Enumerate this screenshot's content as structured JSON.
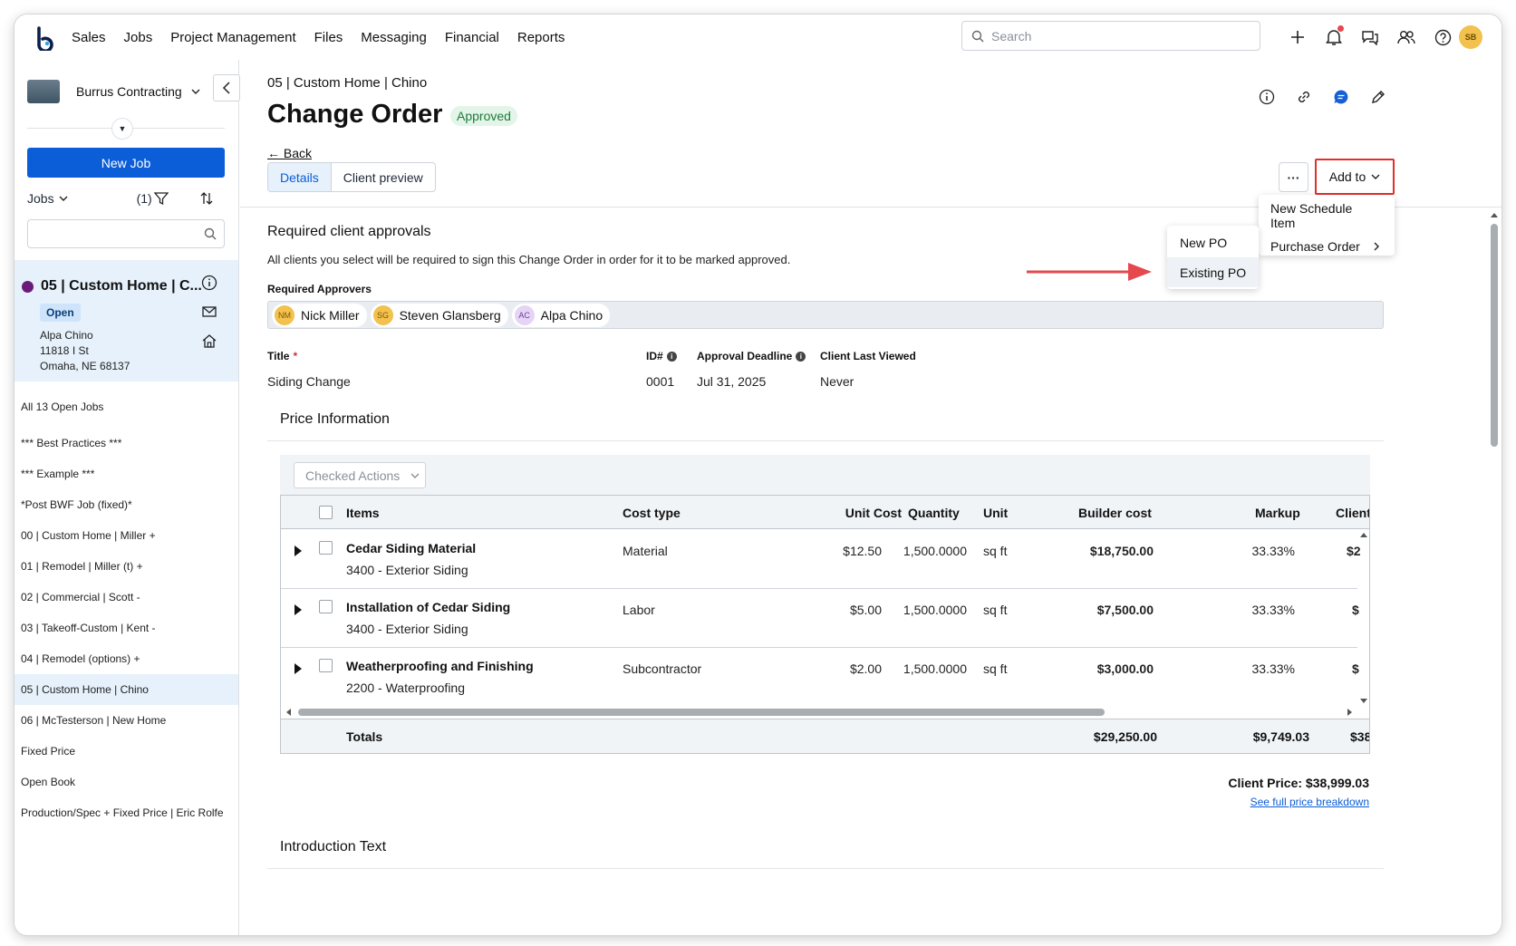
{
  "nav": {
    "links": [
      "Sales",
      "Jobs",
      "Project Management",
      "Files",
      "Messaging",
      "Financial",
      "Reports"
    ],
    "search_placeholder": "Search",
    "user_initials": "SB"
  },
  "sidebar": {
    "company": "Burrus Contracting",
    "new_job": "New Job",
    "jobs_label": "Jobs",
    "filter_count": "(1)",
    "active_job": {
      "title": "05 | Custom Home | C...",
      "status": "Open",
      "address_lines": [
        "Alpa Chino",
        "11818 I St",
        "Omaha, NE 68137"
      ]
    },
    "job_list": [
      "All 13 Open Jobs",
      "*** Best Practices ***",
      "*** Example ***",
      "*Post BWF Job (fixed)*",
      "00 | Custom Home | Miller +",
      "01 | Remodel | Miller (t) +",
      "02 | Commercial | Scott -",
      "03 | Takeoff-Custom | Kent -",
      "04 | Remodel (options) +",
      "05 | Custom Home | Chino",
      "06 | McTesterson | New Home",
      "Fixed Price",
      "Open Book",
      "Production/Spec + Fixed Price | Eric Rolfe"
    ]
  },
  "main": {
    "breadcrumb": "05 | Custom Home | Chino",
    "title": "Change Order",
    "status": "Approved",
    "back": "← Back",
    "tabs": [
      "Details",
      "Client preview"
    ],
    "more": "···",
    "add_to": "Add to",
    "add_to_menu": [
      "New Schedule Item",
      "Purchase Order"
    ],
    "po_menu": [
      "New PO",
      "Existing PO"
    ],
    "approvals": {
      "title": "Required client approvals",
      "description": "All clients you select will be required to sign this Change Order in order for it to be marked approved.",
      "label": "Required Approvers",
      "approvers": [
        {
          "initials": "NM",
          "name": "Nick Miller",
          "color": "#f2c14e"
        },
        {
          "initials": "SG",
          "name": "Steven Glansberg",
          "color": "#f2c14e"
        },
        {
          "initials": "AC",
          "name": "Alpa Chino",
          "color": "#e5d4f5"
        }
      ]
    },
    "fields": {
      "title_label": "Title",
      "title_required": "*",
      "title_value": "Siding Change",
      "id_label": "ID#",
      "id_value": "0001",
      "deadline_label": "Approval Deadline",
      "deadline_value": "Jul 31, 2025",
      "viewed_label": "Client Last Viewed",
      "viewed_value": "Never"
    },
    "price_info_title": "Price Information",
    "checked_actions": "Checked Actions",
    "table": {
      "headers": [
        "Items",
        "Cost type",
        "Unit Cost",
        "Quantity",
        "Unit",
        "Builder cost",
        "Markup",
        "Client"
      ],
      "rows": [
        {
          "item": "Cedar Siding Material",
          "code": "3400 - Exterior Siding",
          "cost_type": "Material",
          "unit_cost": "$12.50",
          "quantity": "1,500.0000",
          "unit": "sq ft",
          "builder_cost": "$18,750.00",
          "markup": "33.33%",
          "client": "$2"
        },
        {
          "item": "Installation of Cedar Siding",
          "code": "3400 - Exterior Siding",
          "cost_type": "Labor",
          "unit_cost": "$5.00",
          "quantity": "1,500.0000",
          "unit": "sq ft",
          "builder_cost": "$7,500.00",
          "markup": "33.33%",
          "client": "$"
        },
        {
          "item": "Weatherproofing and Finishing",
          "code": "2200 - Waterproofing",
          "cost_type": "Subcontractor",
          "unit_cost": "$2.00",
          "quantity": "1,500.0000",
          "unit": "sq ft",
          "builder_cost": "$3,000.00",
          "markup": "33.33%",
          "client": "$"
        }
      ],
      "totals": {
        "label": "Totals",
        "builder_cost": "$29,250.00",
        "markup": "$9,749.03",
        "client": "$38"
      }
    },
    "client_price": "Client Price: $38,999.03",
    "price_breakdown": "See full price breakdown",
    "intro_title": "Introduction Text"
  },
  "colors": {
    "primary": "#0b5ed7",
    "highlight_box": "#e0302a",
    "arrow": "#e5484d",
    "approved_bg": "#e3f5e8"
  }
}
